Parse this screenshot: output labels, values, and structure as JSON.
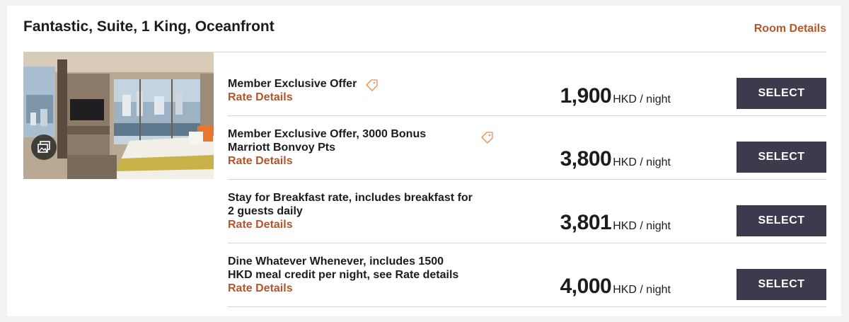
{
  "room": {
    "title": "Fantastic, Suite, 1 King, Oceanfront",
    "details_link": "Room Details"
  },
  "rates": [
    {
      "name_lines": [
        "Member Exclusive Offer"
      ],
      "details_label": "Rate Details",
      "has_tag_icon": true,
      "amount": "1,900",
      "unit": "HKD / night",
      "select_label": "SELECT"
    },
    {
      "name_lines": [
        "Member Exclusive Offer, 3000 Bonus",
        "Marriott Bonvoy Pts"
      ],
      "details_label": "Rate Details",
      "has_tag_icon": true,
      "amount": "3,800",
      "unit": "HKD / night",
      "select_label": "SELECT"
    },
    {
      "name_lines": [
        "Stay for Breakfast rate, includes breakfast for",
        "2 guests daily"
      ],
      "details_label": "Rate Details",
      "has_tag_icon": false,
      "amount": "3,801",
      "unit": "HKD / night",
      "select_label": "SELECT"
    },
    {
      "name_lines": [
        "Dine Whatever Whenever, includes 1500",
        "HKD meal credit per night, see Rate details"
      ],
      "details_label": "Rate Details",
      "has_tag_icon": false,
      "amount": "4,000",
      "unit": "HKD / night",
      "select_label": "SELECT"
    }
  ],
  "icons": {
    "tag": "tag-icon",
    "gallery": "gallery-icon"
  },
  "colors": {
    "accent": "#b5552b",
    "button": "#3b3b4d",
    "tag_icon": "#e8a070"
  }
}
